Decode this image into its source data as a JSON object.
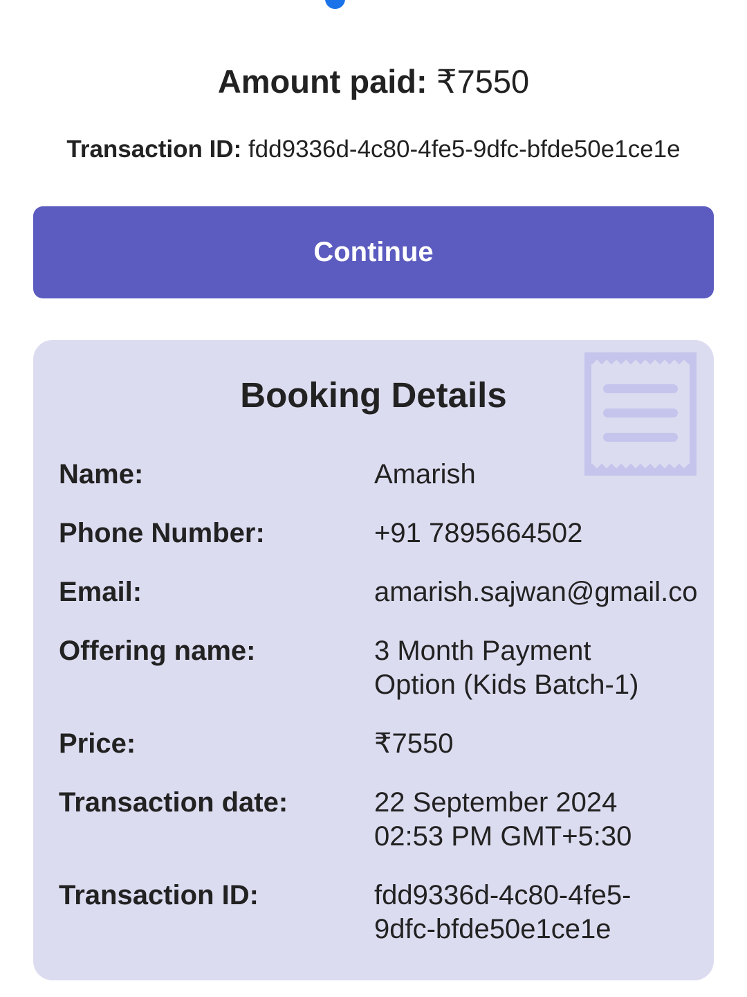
{
  "summary": {
    "amount_label": "Amount paid:",
    "amount_value": "₹7550",
    "transaction_label": "Transaction ID:",
    "transaction_value": "fdd9336d-4c80-4fe5-9dfc-bfde50e1ce1e"
  },
  "continue_button": {
    "label": "Continue"
  },
  "booking": {
    "title": "Booking Details",
    "icon": "receipt-icon",
    "rows": [
      {
        "label": "Name:",
        "value": "Amarish"
      },
      {
        "label": "Phone Number:",
        "value": "+91 7895664502"
      },
      {
        "label": "Email:",
        "value": "amarish.sajwan@gmail.co"
      },
      {
        "label": "Offering name:",
        "value_line1": "3 Month Payment",
        "value_line2": "Option (Kids Batch-1)"
      },
      {
        "label": "Price:",
        "value": "₹7550"
      },
      {
        "label": "Transaction date:",
        "value_line1": "22 September 2024",
        "value_line2": "02:53 PM GMT+5:30"
      },
      {
        "label": "Transaction ID:",
        "value_line1": "fdd9336d-4c80-4fe5-",
        "value_line2": "9dfc-bfde50e1ce1e"
      }
    ]
  },
  "colors": {
    "primary": "#5b5bc0",
    "card_background": "#dcdcf1",
    "icon_tint": "#c4c4ec",
    "progress_dot": "#1a73e8"
  }
}
